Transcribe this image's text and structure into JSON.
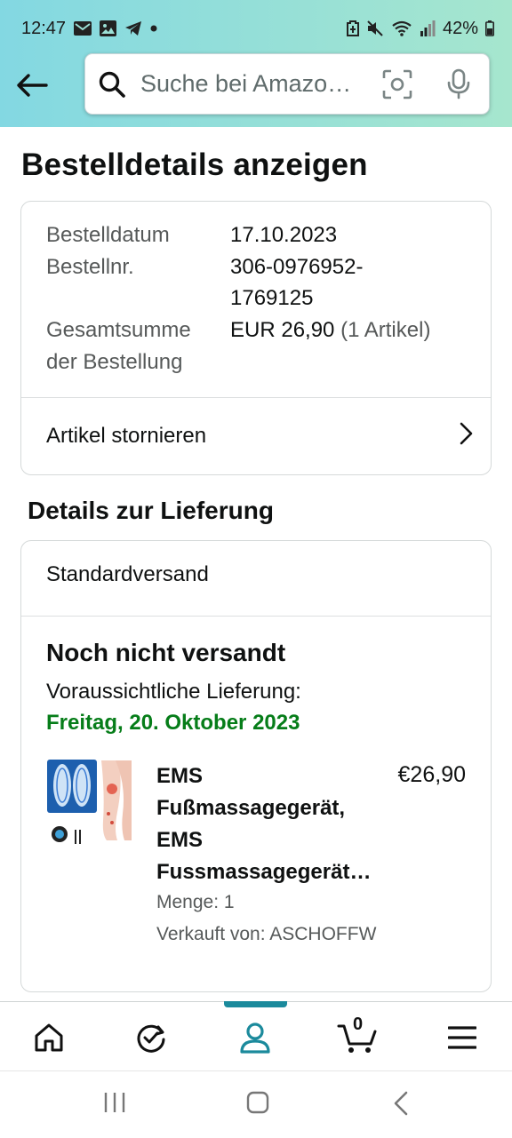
{
  "status_bar": {
    "time": "12:47",
    "battery": "42%",
    "left_icons": [
      "mail-icon",
      "image-icon",
      "telegram-icon",
      "dot-icon"
    ],
    "right_icons": [
      "battery-saver-icon",
      "mute-icon",
      "wifi-icon",
      "signal-icon",
      "battery-icon"
    ]
  },
  "search": {
    "placeholder": "Suche bei Amazo…"
  },
  "page": {
    "title": "Bestelldetails anzeigen"
  },
  "order_summary": {
    "date_label": "Bestelldatum",
    "date_value": "17.10.2023",
    "number_label": "Bestellnr.",
    "number_value_line1": "306-0976952-",
    "number_value_line2": "1769125",
    "total_label_line1": "Gesamtsumme",
    "total_label_line2": "der Bestellung",
    "total_value": "EUR 26,90",
    "total_items": "(1 Artikel)",
    "cancel_label": "Artikel stornieren"
  },
  "delivery": {
    "section_title": "Details zur Lieferung",
    "shipping_method": "Standardversand",
    "status": "Noch nicht versandt",
    "estimate_label": "Voraussichtliche Lieferung:",
    "estimate_date": "Freitag, 20. Oktober 2023",
    "product": {
      "title_line1": "EMS",
      "title_line2": "Fußmassagegerät,",
      "title_line3": "EMS",
      "title_line4": "Fussmassagegerät…",
      "price": "€26,90",
      "quantity": "Menge: 1",
      "seller": "Verkauft von: ASCHOFFW"
    }
  },
  "bottom_nav": {
    "items": [
      "home-icon",
      "buy-again-icon",
      "account-icon",
      "cart-icon",
      "menu-icon"
    ],
    "active": "account-icon",
    "cart_count": "0"
  },
  "colors": {
    "header_gradient_start": "#83d8e2",
    "header_gradient_end": "#a6e6ce",
    "delivery_date_green": "#067d19",
    "active_teal": "#1b8a9c"
  }
}
